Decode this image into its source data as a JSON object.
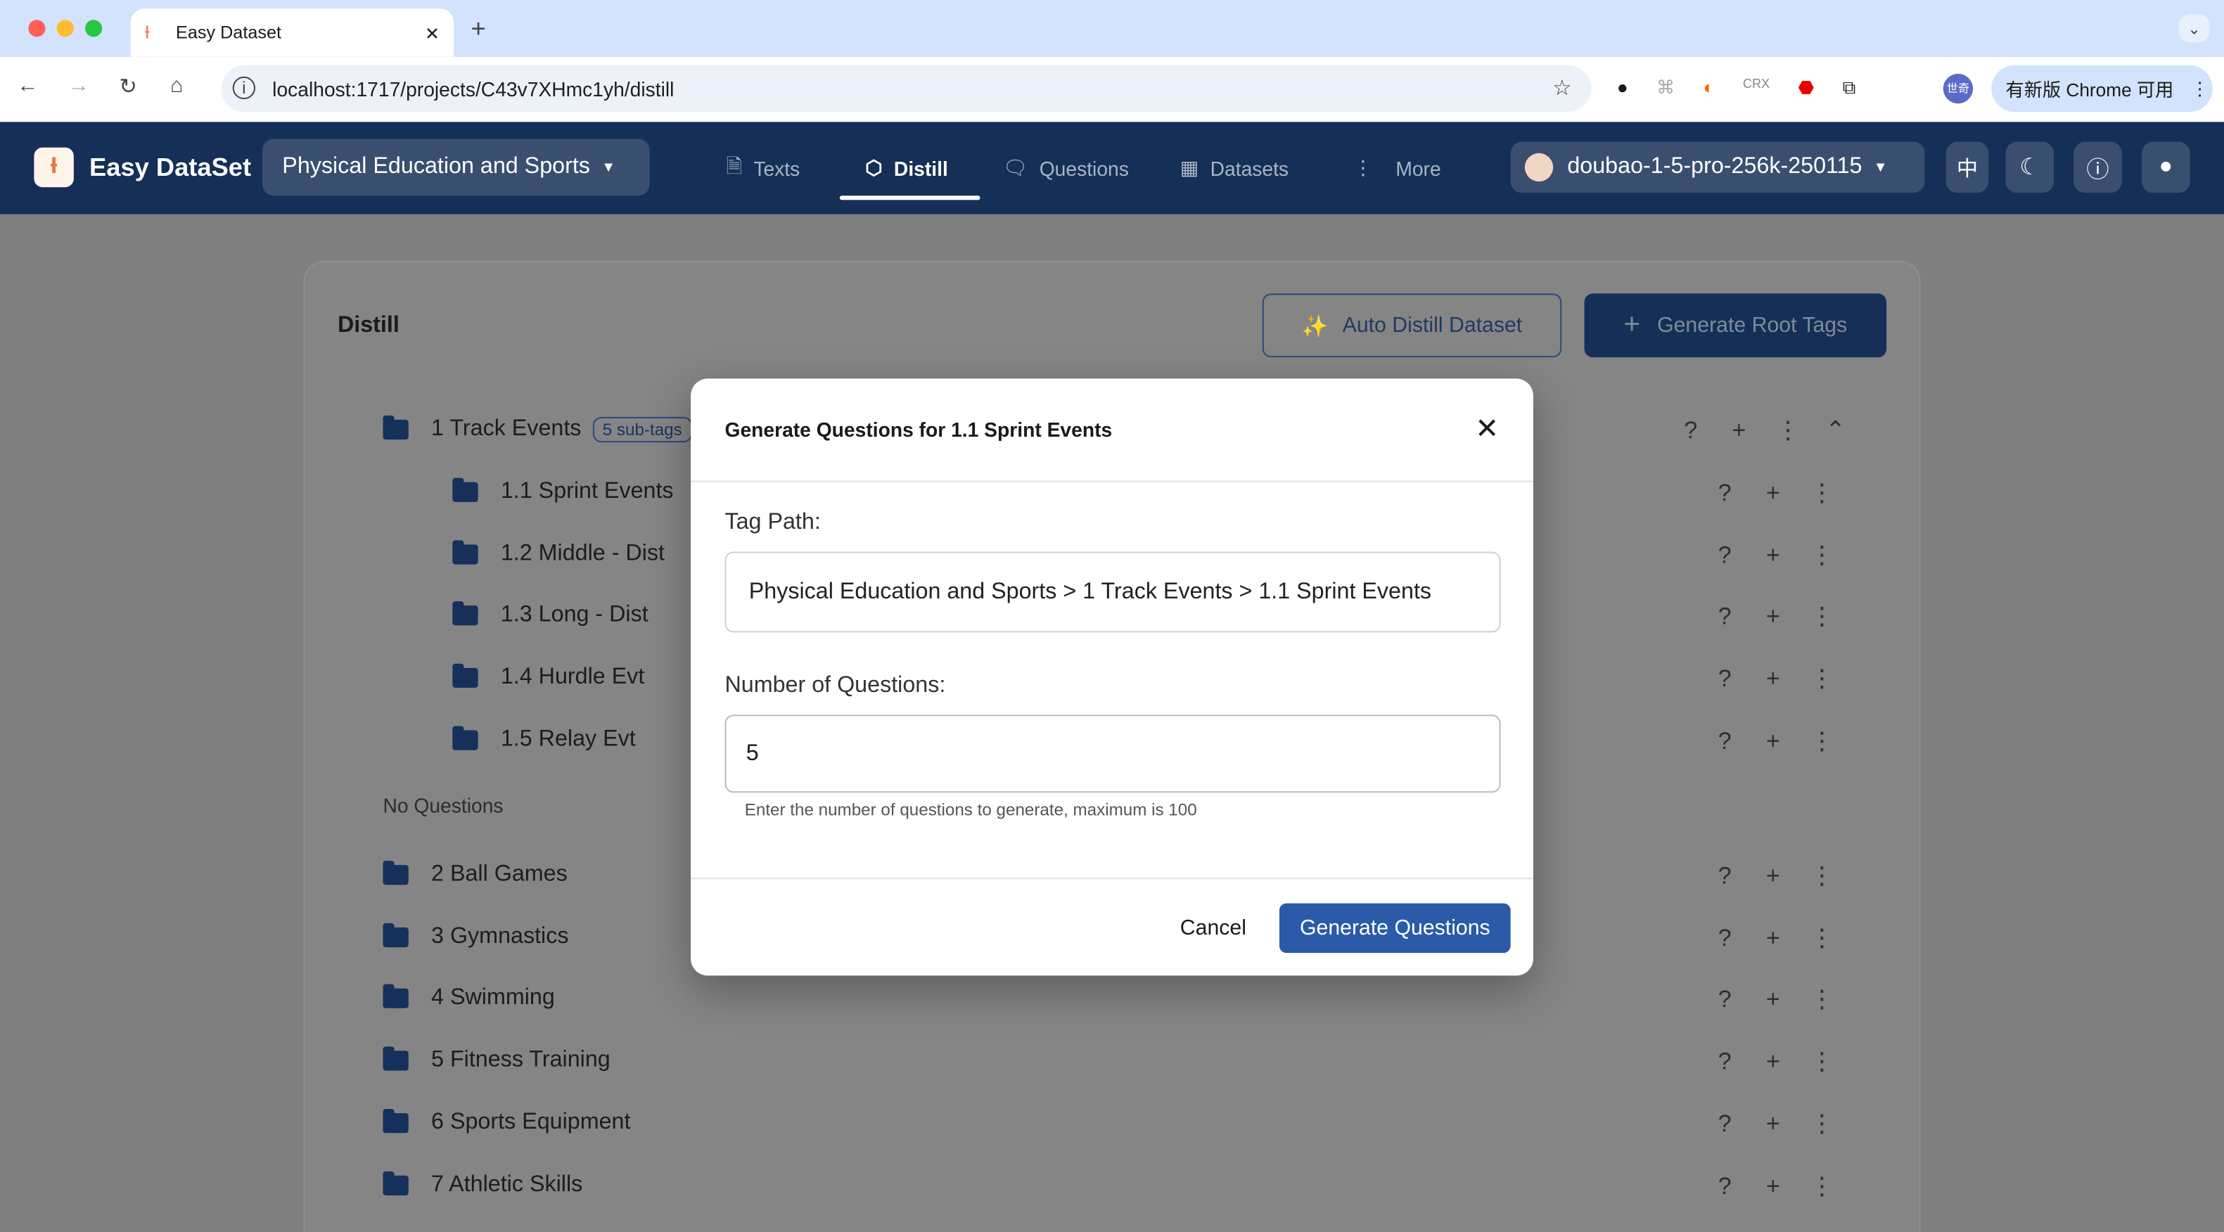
{
  "browser": {
    "tab_title": "Easy Dataset",
    "url": "localhost:1717/projects/C43v7XHmc1yh/distill",
    "update_label": "有新版 Chrome 可用"
  },
  "app": {
    "name": "Easy DataSet",
    "project": "Physical Education and Sports",
    "nav": [
      {
        "label": "Texts",
        "icon": "file-icon"
      },
      {
        "label": "Distill",
        "icon": "cube-icon",
        "active": true
      },
      {
        "label": "Questions",
        "icon": "chat-icon"
      },
      {
        "label": "Datasets",
        "icon": "grid-icon"
      },
      {
        "label": "More",
        "icon": "dots-vertical-icon"
      }
    ],
    "model": "doubao-1-5-pro-256k-250115",
    "lang_label": "中"
  },
  "page": {
    "title": "Distill",
    "auto_button": "Auto Distill Dataset",
    "root_button": "Generate Root Tags",
    "no_questions": "No Questions",
    "root_tag": {
      "label": "1 Track Events",
      "badge": "5 sub-tags"
    },
    "sub_tags": [
      "1.1 Sprint Events",
      "1.2 Middle - Dist",
      "1.3 Long - Dist",
      "1.4 Hurdle Evt",
      "1.5 Relay Evt"
    ],
    "tags": [
      "2 Ball Games",
      "3 Gymnastics",
      "4 Swimming",
      "5 Fitness Training",
      "6 Sports Equipment",
      "7 Athletic Skills"
    ]
  },
  "dialog": {
    "title": "Generate Questions for 1.1 Sprint Events",
    "tag_path_label": "Tag Path:",
    "tag_path": "Physical Education and Sports > 1 Track Events > 1.1 Sprint Events",
    "count_label": "Number of Questions:",
    "count": "5",
    "helper": "Enter the number of questions to generate, maximum is 100",
    "cancel": "Cancel",
    "submit": "Generate Questions"
  },
  "colors": {
    "nav": "#152f57",
    "primary": "#2a5aa8"
  }
}
